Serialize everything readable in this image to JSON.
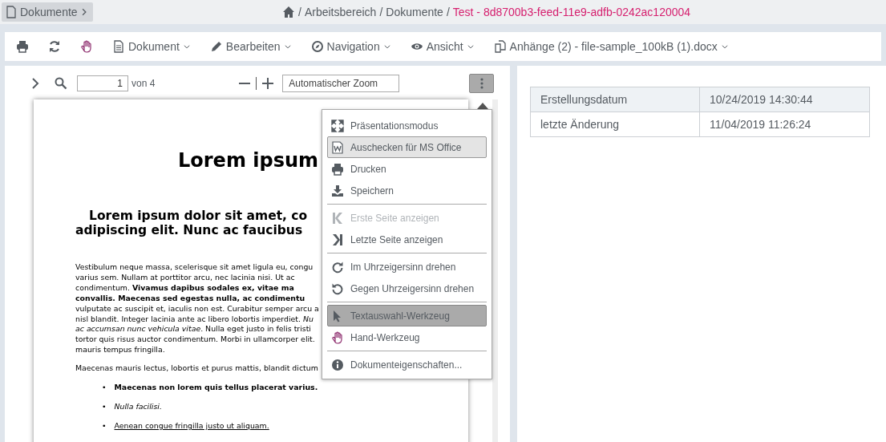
{
  "topbar": {
    "back_button": "Dokumente",
    "breadcrumb": [
      {
        "separator": "/",
        "label": "Arbeitsbereich"
      },
      {
        "separator": "/",
        "label": "Dokumente"
      }
    ],
    "current_separator": "/",
    "current": "Test - 8d8700b3-feed-11e9-adfb-0242ac120004"
  },
  "toolbar": {
    "menus": [
      "Dokument",
      "Bearbeiten",
      "Navigation",
      "Ansicht",
      "Anhänge (2) - file-sample_100kB (1).docx"
    ]
  },
  "viewer": {
    "page_number": "1",
    "page_count": "von 4",
    "zoom": "Automatischer Zoom",
    "document": {
      "title": "Lorem ipsum",
      "subtitle": [
        "Lorem ipsum dolor sit amet, co",
        "adipiscing elit. Nunc ac faucibus"
      ],
      "paragraphs": [
        [
          "Vestibulum neque massa, scelerisque sit amet ligula eu, congu",
          "varius sem. Nullam at porttitor arcu, nec lacinia nisi. Ut ac",
          "condimentum. **Vivamus dapibus sodales ex, vitae ma**",
          "**convallis. Maecenas sed egestas nulla, ac condimentu**",
          "vulputate ac suscipit et, iaculis non est. Curabitur semper arcu a",
          "nisl blandit. Integer lacinia ante ac libero lobortis imperdiet. *Nu*",
          "*ac accumsan nunc vehicula vitae*. Nulla eget justo in felis tristi",
          "tortor quis risus auctor condimentum. Morbi in ullamcorper elit.",
          "mauris tempus fringilla."
        ],
        [
          "Maecenas mauris lectus, lobortis et purus mattis, blandit dictum"
        ]
      ],
      "bullets": [
        {
          "marker": "•",
          "text": "Maecenas non lorem quis tellus placerat varius."
        },
        {
          "marker": "•",
          "text": "Nulla facilisi."
        },
        {
          "marker": "•",
          "text": "Aenean congue fringilla justo ut aliquam."
        }
      ]
    },
    "menu": [
      {
        "kind": "item",
        "label": "Präsentationsmodus",
        "disabled": false,
        "hovered": false,
        "selected": false
      },
      {
        "kind": "item",
        "label": "Auschecken für MS Office",
        "disabled": false,
        "hovered": true,
        "selected": false
      },
      {
        "kind": "item",
        "label": "Drucken",
        "disabled": false,
        "hovered": false,
        "selected": false
      },
      {
        "kind": "item",
        "label": "Speichern",
        "disabled": false,
        "hovered": false,
        "selected": false
      },
      {
        "kind": "separator"
      },
      {
        "kind": "item",
        "label": "Erste Seite anzeigen",
        "disabled": true,
        "hovered": false,
        "selected": false
      },
      {
        "kind": "item",
        "label": "Letzte Seite anzeigen",
        "disabled": false,
        "hovered": false,
        "selected": false
      },
      {
        "kind": "separator"
      },
      {
        "kind": "item",
        "label": "Im Uhrzeigersinn drehen",
        "disabled": false,
        "hovered": false,
        "selected": false
      },
      {
        "kind": "item",
        "label": "Gegen Uhrzeigersinn drehen",
        "disabled": false,
        "hovered": false,
        "selected": false
      },
      {
        "kind": "separator"
      },
      {
        "kind": "item",
        "label": "Textauswahl-Werkzeug",
        "disabled": false,
        "hovered": false,
        "selected": true
      },
      {
        "kind": "item",
        "label": "Hand-Werkzeug",
        "disabled": false,
        "hovered": false,
        "selected": false
      },
      {
        "kind": "separator"
      },
      {
        "kind": "item",
        "label": "Dokumenteigenschaften...",
        "disabled": false,
        "hovered": false,
        "selected": false
      }
    ]
  },
  "properties": [
    {
      "label": "Erstellungsdatum",
      "value": "10/24/2019 14:30:44"
    },
    {
      "label": "letzte Änderung",
      "value": "11/04/2019 11:26:24"
    }
  ]
}
